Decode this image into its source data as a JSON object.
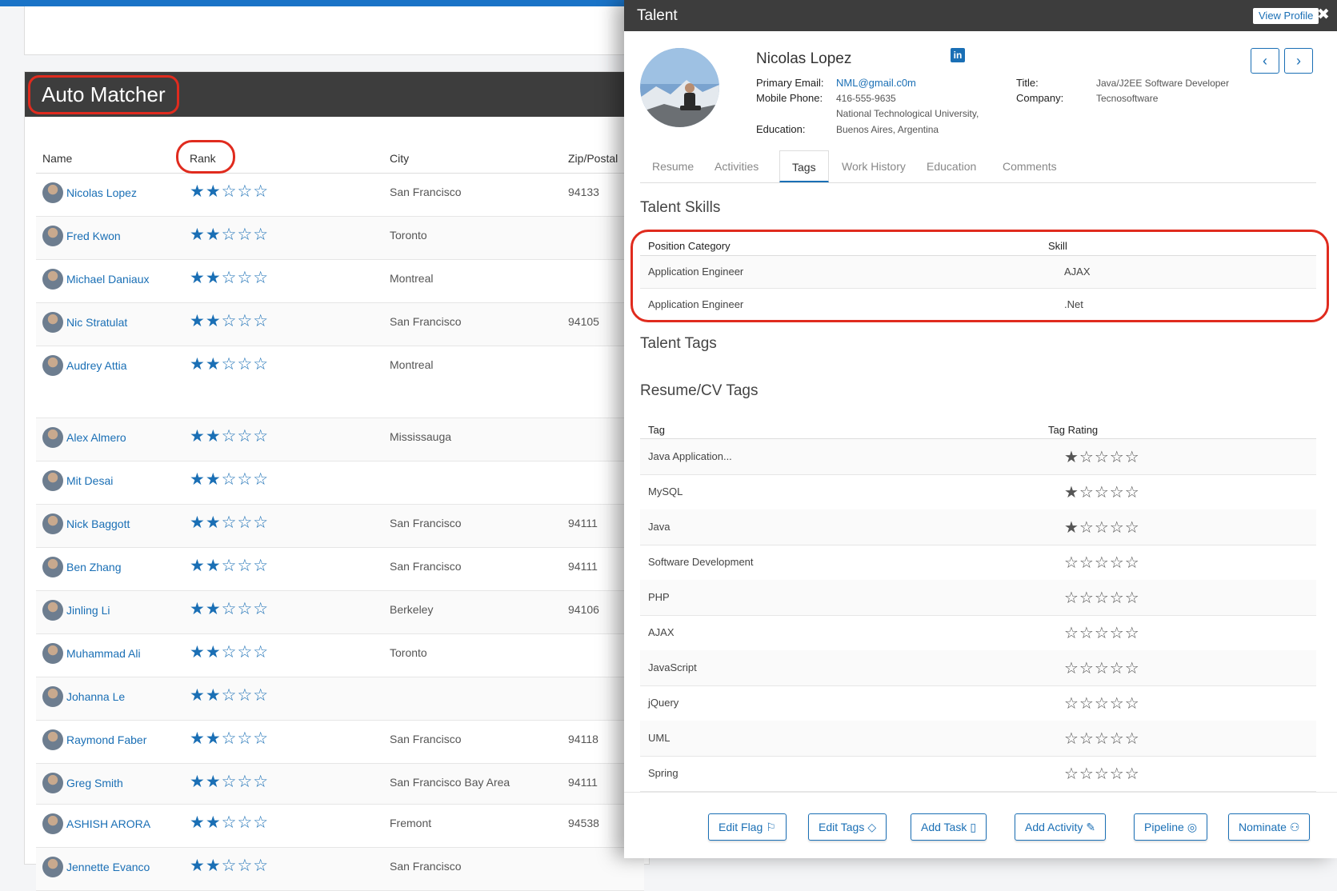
{
  "background": {
    "title": "Auto Matcher",
    "columns": {
      "name": "Name",
      "rank": "Rank",
      "city": "City",
      "zip": "Zip/Postal"
    },
    "rows": [
      {
        "name": "Nicolas Lopez",
        "city": "San Francisco",
        "zip": "94133",
        "rank": 2,
        "max": 5
      },
      {
        "name": "Fred Kwon",
        "city": "Toronto",
        "zip": "",
        "rank": 2,
        "max": 5
      },
      {
        "name": "Michael Daniaux",
        "city": "Montreal",
        "zip": "",
        "rank": 2,
        "max": 5
      },
      {
        "name": "Nic Stratulat",
        "city": "San Francisco",
        "zip": "94105",
        "rank": 2,
        "max": 5
      },
      {
        "name": "Audrey Attia",
        "city": "Montreal",
        "zip": "",
        "rank": 2,
        "max": 5
      },
      {
        "name": "Alex Almero",
        "city": "Mississauga",
        "zip": "",
        "rank": 2,
        "max": 5
      },
      {
        "name": "Mit Desai",
        "city": "",
        "zip": "",
        "rank": 2,
        "max": 5
      },
      {
        "name": "Nick Baggott",
        "city": "San Francisco",
        "zip": "94111",
        "rank": 2,
        "max": 5
      },
      {
        "name": "Ben Zhang",
        "city": "San Francisco",
        "zip": "94111",
        "rank": 2,
        "max": 5
      },
      {
        "name": "Jinling Li",
        "city": "Berkeley",
        "zip": "94106",
        "rank": 2,
        "max": 5
      },
      {
        "name": "Muhammad Ali",
        "city": "Toronto",
        "zip": "",
        "rank": 2,
        "max": 5
      },
      {
        "name": "Johanna Le",
        "city": "",
        "zip": "",
        "rank": 2,
        "max": 5
      },
      {
        "name": "Raymond Faber",
        "city": "San Francisco",
        "zip": "94118",
        "rank": 2,
        "max": 5
      },
      {
        "name": "Greg Smith",
        "city": "San Francisco Bay Area",
        "zip": "94111",
        "rank": 2,
        "max": 5
      },
      {
        "name": "ASHISH ARORA",
        "city": "Fremont",
        "zip": "94538",
        "rank": 2,
        "max": 5
      },
      {
        "name": "Jennette Evanco",
        "city": "San Francisco",
        "zip": "",
        "rank": 2,
        "max": 5
      }
    ]
  },
  "panel": {
    "title": "Talent",
    "view_profile": "View Profile",
    "close_icon": "✖",
    "linkedin_icon": "in",
    "profile": {
      "name": "Nicolas Lopez",
      "labels": {
        "email": "Primary Email:",
        "phone": "Mobile Phone:",
        "education": "Education:",
        "title": "Title:",
        "company": "Company:"
      },
      "email": "NML@gmail.c0m",
      "phone": "416-555-9635",
      "education_line1": "National Technological University,",
      "education_line2": "Buenos Aires, Argentina",
      "title": "Java/J2EE Software Developer",
      "company": "Tecnosoftware"
    },
    "nav": {
      "prev": "‹",
      "next": "›"
    },
    "tabs": [
      "Resume",
      "Activities",
      "Tags",
      "Work History",
      "Education",
      "Comments"
    ],
    "active_tab": "Tags",
    "talent_skills": {
      "title": "Talent Skills",
      "headers": [
        "Position Category",
        "Skill"
      ],
      "rows": [
        {
          "category": "Application Engineer",
          "skill": "AJAX"
        },
        {
          "category": "Application Engineer",
          "skill": ".Net"
        }
      ]
    },
    "talent_tags_title": "Talent Tags",
    "resume_tags": {
      "title": "Resume/CV Tags",
      "headers": [
        "Tag",
        "Tag Rating"
      ],
      "rows": [
        {
          "tag": "Java Application...",
          "rating": 1,
          "max": 5
        },
        {
          "tag": "MySQL",
          "rating": 1,
          "max": 5
        },
        {
          "tag": "Java",
          "rating": 1,
          "max": 5
        },
        {
          "tag": "Software Development",
          "rating": 0,
          "max": 5
        },
        {
          "tag": "PHP",
          "rating": 0,
          "max": 5
        },
        {
          "tag": "AJAX",
          "rating": 0,
          "max": 5
        },
        {
          "tag": "JavaScript",
          "rating": 0,
          "max": 5
        },
        {
          "tag": "jQuery",
          "rating": 0,
          "max": 5
        },
        {
          "tag": "UML",
          "rating": 0,
          "max": 5
        },
        {
          "tag": "Spring",
          "rating": 0,
          "max": 5
        }
      ]
    },
    "actions": [
      {
        "label": "Edit Flag",
        "icon": "⚐"
      },
      {
        "label": "Edit Tags",
        "icon": "◇"
      },
      {
        "label": "Add Task",
        "icon": "▯"
      },
      {
        "label": "Add Activity",
        "icon": "✎"
      },
      {
        "label": "Pipeline",
        "icon": "◎"
      },
      {
        "label": "Nominate",
        "icon": "⚇"
      }
    ]
  }
}
